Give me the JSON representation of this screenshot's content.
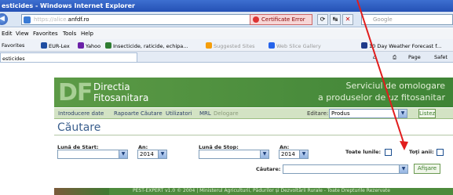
{
  "window": {
    "title": "esticides - Windows Internet Explorer"
  },
  "address": {
    "url_prefix": "https://alice.",
    "url_domain": "anfdf.ro",
    "cert_label": "Certificate Error",
    "search_placeholder": "Google"
  },
  "menu": {
    "items": [
      "Edit",
      "View",
      "Favorites",
      "Tools",
      "Help"
    ]
  },
  "favorites": {
    "label": "Favorites",
    "items": [
      {
        "label": "EUR-Lex",
        "color": "#1e4da1"
      },
      {
        "label": "Yahoo",
        "color": "#6b21a8"
      },
      {
        "label": "Insecticide, raticide, echipa...",
        "color": "#2e7d32"
      },
      {
        "label": "Suggested Sites",
        "color": "#f59e0b"
      },
      {
        "label": "Web Slice Gallery",
        "color": "#2563eb"
      },
      {
        "label": "10 Day Weather Forecast f...",
        "color": "#1e3a8a"
      }
    ]
  },
  "tab": {
    "label": "esticides"
  },
  "commandbar": {
    "page": "Page",
    "safety": "Safet"
  },
  "site": {
    "logo": "DF",
    "brand_line1": "Directia",
    "brand_line2": "Fitosanitara",
    "tagline1": "Serviciul de omologare",
    "tagline2": "a produselor de uz fitosanitar",
    "nav": [
      "Introducere date",
      "Rapoarte",
      "Căutare",
      "Utilizatori",
      "MRL",
      "Delogare"
    ],
    "editare_label": "Editare:",
    "editare_value": "Produs",
    "listez_button": "Listez"
  },
  "form": {
    "title": "Căutare",
    "luna_start_label": "Lună de Start:",
    "an_start_label": "An:",
    "an_start_value": "2014",
    "luna_stop_label": "Lună de Stop:",
    "an_stop_label": "An:",
    "an_stop_value": "2014",
    "toate_lunile_label": "Toate lunile:",
    "toti_anii_label": "Toţi anii:",
    "cautare_label": "Căutare:",
    "afisare_button": "Afişare"
  },
  "footer": {
    "text": "PEST-EXPERT v1.0 © 2004 | Ministerul Agriculturii, Pădurilor și Dezvoltării Rurale - Toate Drepturile Rezervate"
  },
  "colors": {
    "header_green": "#4d8a3c",
    "link_blue": "#2b3f68",
    "annotation_red": "#e11d1d"
  }
}
